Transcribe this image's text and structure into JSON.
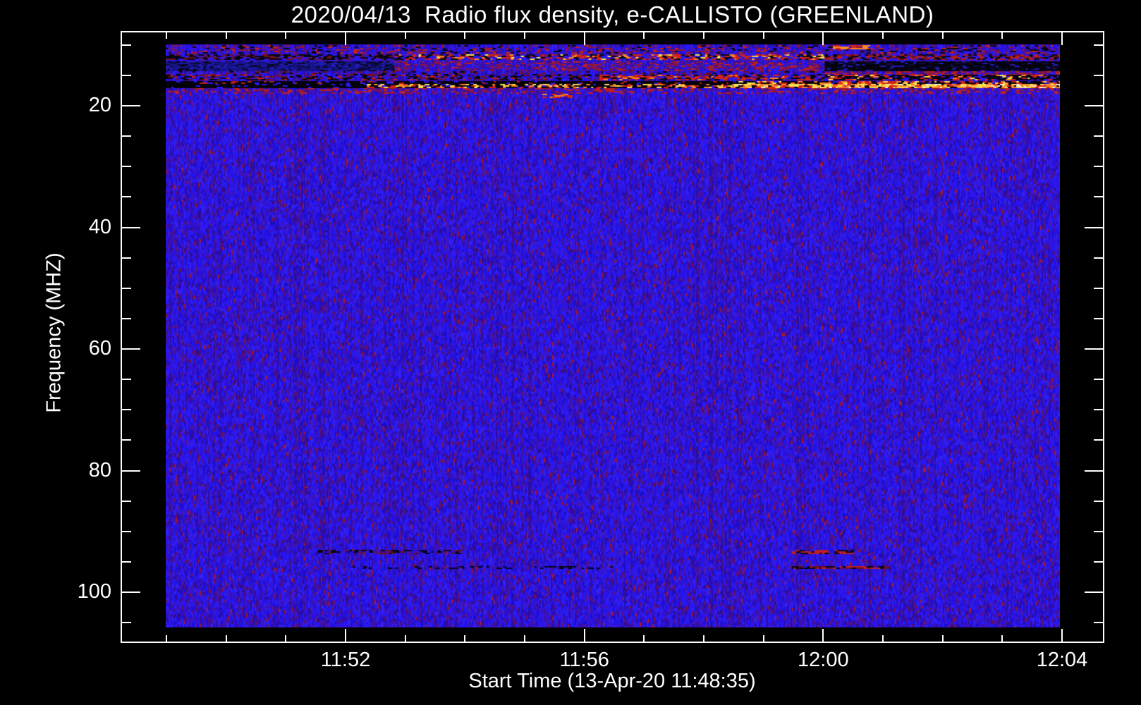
{
  "chart_data": {
    "type": "heatmap",
    "title": "2020/04/13  Radio flux density, e-CALLISTO (GREENLAND)",
    "xlabel": "Start Time (13-Apr-20 11:48:35)",
    "ylabel": "Frequency (MHZ)",
    "date": "2020/04/13",
    "instrument": "e-CALLISTO (GREENLAND)",
    "x_axis": {
      "start_time_label": "11:48:35",
      "major_ticks": [
        {
          "minute": 4,
          "label": "11:52"
        },
        {
          "minute": 8,
          "label": "11:56"
        },
        {
          "minute": 12,
          "label": "12:00"
        },
        {
          "minute": 16,
          "label": "12:04"
        }
      ],
      "minor_tick_every_minutes": 1
    },
    "y_axis": {
      "unit": "MHz",
      "direction": "increasing-downward",
      "major_ticks": [
        {
          "freq": 20,
          "label": "20"
        },
        {
          "freq": 40,
          "label": "40"
        },
        {
          "freq": 60,
          "label": "60"
        },
        {
          "freq": 80,
          "label": "80"
        },
        {
          "freq": 100,
          "label": "100"
        }
      ],
      "minor_tick_every": 5,
      "minor_range": [
        10,
        105
      ],
      "data_freq_range": [
        10,
        106
      ]
    },
    "colormap": {
      "description": "blue background noise, red-orange-yellow for strong flux, black for low flux",
      "background_blue": "#2a17ee",
      "strong_red": "#d42410",
      "strong_orange": "#ff8820",
      "strong_yellow": "#ffe44e",
      "low_black": "#020208",
      "base_noise": [
        [
          "#2a17ee",
          0.28
        ],
        [
          "#2311e2",
          0.17
        ],
        [
          "#3020f4",
          0.13
        ],
        [
          "#1c0dc8",
          0.08
        ],
        [
          "#3915cc",
          0.11
        ],
        [
          "#43109e",
          0.09
        ],
        [
          "#350b8c",
          0.06
        ],
        [
          "#55107a",
          0.04
        ],
        [
          "#6e105a",
          0.02
        ],
        [
          "#8a1540",
          0.013
        ],
        [
          "#a5182e",
          0.007
        ]
      ],
      "dark_column": [
        [
          "#2e0e9a",
          0.4
        ],
        [
          "#1c0dc8",
          0.25
        ],
        [
          "#43109e",
          0.2
        ],
        [
          "#55107a",
          0.15
        ]
      ]
    },
    "rfi_bands": [
      {
        "f0": 10.05,
        "f1": 11.3,
        "desc": "top row: blue with sparse red and black dashes",
        "segments": [
          {
            "x0": 0,
            "x1": 1,
            "palette": [
              [
                "none",
                0.72
              ],
              [
                "#8a1540",
                0.1
              ],
              [
                "#c02020",
                0.08
              ],
              [
                "#050510",
                0.1
              ]
            ]
          }
        ]
      },
      {
        "f0": 10.0,
        "f1": 10.7,
        "desc": "small orange dash cluster just left of 12:00",
        "segments": [
          {
            "x0": 0.746,
            "x1": 0.788,
            "palette": [
              [
                "#ff8820",
                0.45
              ],
              [
                "#d42410",
                0.3
              ],
              [
                "none",
                0.25
              ]
            ]
          }
        ]
      },
      {
        "f0": 11.5,
        "f1": 12.5,
        "desc": "RFI band ~12 MHz: dark left, bright red/yellow speckles mid, red right",
        "segments": [
          {
            "x0": 0,
            "x1": 0.256,
            "palette": [
              [
                "#050510",
                0.4
              ],
              [
                "#70101c",
                0.18
              ],
              [
                "#2a17ee",
                0.22
              ],
              [
                "#55107a",
                0.2
              ]
            ]
          },
          {
            "x0": 0.256,
            "x1": 0.737,
            "palette": [
              [
                "#d42410",
                0.2
              ],
              [
                "#ff8820",
                0.1
              ],
              [
                "#ffe44e",
                0.07
              ],
              [
                "#050510",
                0.2
              ],
              [
                "#2a17ee",
                0.28
              ],
              [
                "#8a1540",
                0.15
              ]
            ]
          },
          {
            "x0": 0.737,
            "x1": 1,
            "palette": [
              [
                "#b81e14",
                0.22
              ],
              [
                "#70101c",
                0.2
              ],
              [
                "#050510",
                0.28
              ],
              [
                "#2a17ee",
                0.3
              ]
            ]
          }
        ]
      },
      {
        "f0": 12.7,
        "f1": 14.3,
        "desc": "~13 MHz: dark wash left, faint red middle, solid black band right of 12:00",
        "segments": [
          {
            "x0": 0,
            "x1": 0.256,
            "palette": [
              [
                "#151283",
                0.45
              ],
              [
                "#0a0a3c",
                0.25
              ],
              [
                "#221bb0",
                0.2
              ],
              [
                "#05050f",
                0.1
              ]
            ]
          },
          {
            "x0": 0.256,
            "x1": 0.737,
            "palette": [
              [
                "none",
                0.55
              ],
              [
                "#8a1540",
                0.2
              ],
              [
                "#c02020",
                0.1
              ],
              [
                "#43109e",
                0.15
              ]
            ]
          },
          {
            "x0": 0.737,
            "x1": 1,
            "palette": [
              [
                "#020208",
                0.78
              ],
              [
                "#0d0d35",
                0.12
              ],
              [
                "#221bb0",
                0.1
              ]
            ]
          }
        ]
      },
      {
        "f0": 14.3,
        "f1": 14.9,
        "desc": "faint red dash row, stronger right of 12:00",
        "segments": [
          {
            "x0": 0,
            "x1": 0.737,
            "palette": [
              [
                "none",
                0.8
              ],
              [
                "#70101c",
                0.12
              ],
              [
                "#050510",
                0.08
              ]
            ]
          },
          {
            "x0": 0.737,
            "x1": 1,
            "palette": [
              [
                "#c02020",
                0.25
              ],
              [
                "#8a1540",
                0.2
              ],
              [
                "none",
                0.55
              ]
            ]
          }
        ]
      },
      {
        "f0": 14.9,
        "f1": 15.8,
        "desc": "~15 MHz speckled dark/red line; black right of 12:00",
        "segments": [
          {
            "x0": 0,
            "x1": 0.485,
            "palette": [
              [
                "#050510",
                0.22
              ],
              [
                "#70101c",
                0.15
              ],
              [
                "none",
                0.55
              ],
              [
                "#c02020",
                0.08
              ]
            ]
          },
          {
            "x0": 0.485,
            "x1": 0.737,
            "palette": [
              [
                "#d42410",
                0.3
              ],
              [
                "#ff8820",
                0.06
              ],
              [
                "#050510",
                0.22
              ],
              [
                "none",
                0.35
              ],
              [
                "#8a1540",
                0.07
              ]
            ]
          },
          {
            "x0": 0.737,
            "x1": 1,
            "palette": [
              [
                "#020208",
                0.6
              ],
              [
                "#d42410",
                0.16
              ],
              [
                "none",
                0.16
              ],
              [
                "#ff8820",
                0.05
              ],
              [
                "#ffe44e",
                0.03
              ]
            ]
          }
        ]
      },
      {
        "f0": 15.9,
        "f1": 16.4,
        "desc": "~16 MHz black band upper part with growing bright dashes",
        "segments": [
          {
            "x0": 0,
            "x1": 0.635,
            "palette": [
              [
                "#020208",
                0.8
              ],
              [
                "#b81e14",
                0.1
              ],
              [
                "#2a17ee",
                0.1
              ]
            ]
          },
          {
            "x0": 0.635,
            "x1": 1,
            "palette": [
              [
                "#020208",
                0.45
              ],
              [
                "#d42410",
                0.22
              ],
              [
                "#ff8820",
                0.15
              ],
              [
                "#ffe44e",
                0.1
              ],
              [
                "#2a17ee",
                0.08
              ]
            ]
          }
        ]
      },
      {
        "f0": 16.4,
        "f1": 17.0,
        "desc": "brightest band ~17 MHz: solid black left, yellow/orange speckles toward right",
        "segments": [
          {
            "x0": 0,
            "x1": 0.225,
            "palette": [
              [
                "#020208",
                0.9
              ],
              [
                "#2a17ee",
                0.1
              ]
            ]
          },
          {
            "x0": 0.225,
            "x1": 0.635,
            "palette": [
              [
                "#020208",
                0.45
              ],
              [
                "#ffe44e",
                0.2
              ],
              [
                "#ff8820",
                0.15
              ],
              [
                "#d42410",
                0.15
              ],
              [
                "#2a17ee",
                0.05
              ]
            ]
          },
          {
            "x0": 0.635,
            "x1": 1,
            "palette": [
              [
                "#ffe44e",
                0.38
              ],
              [
                "#ff8820",
                0.28
              ],
              [
                "#d42410",
                0.15
              ],
              [
                "#020208",
                0.12
              ],
              [
                "#fff8c0",
                0.07
              ]
            ]
          }
        ]
      },
      {
        "f0": 17.1,
        "f1": 17.9,
        "desc": "blue with moderate red speckles below bright band",
        "segments": [
          {
            "x0": 0,
            "x1": 1,
            "palette": [
              [
                "none",
                0.6
              ],
              [
                "#c02020",
                0.15
              ],
              [
                "#8a1540",
                0.13
              ],
              [
                "#43109e",
                0.12
              ]
            ]
          }
        ]
      },
      {
        "f0": 18.0,
        "f1": 18.7,
        "desc": "small orange dash cluster near 11:55",
        "segments": [
          {
            "x0": 0.421,
            "x1": 0.455,
            "palette": [
              [
                "#ff8820",
                0.4
              ],
              [
                "#d42410",
                0.35
              ],
              [
                "none",
                0.25
              ]
            ]
          }
        ]
      },
      {
        "f0": 93.1,
        "f1": 93.6,
        "desc": "faint interference line ~93 MHz with red dashes near 12:00",
        "segments": [
          {
            "x0": 0.17,
            "x1": 0.33,
            "palette": [
              [
                "#050510",
                0.3
              ],
              [
                "#70101c",
                0.2
              ],
              [
                "none",
                0.5
              ]
            ]
          },
          {
            "x0": 0.7,
            "x1": 0.77,
            "palette": [
              [
                "#c02020",
                0.4
              ],
              [
                "#050510",
                0.25
              ],
              [
                "none",
                0.35
              ]
            ]
          }
        ]
      },
      {
        "f0": 95.7,
        "f1": 96.2,
        "desc": "faint interference line ~96 MHz with dark/red dashes near 12:00",
        "segments": [
          {
            "x0": 0.2,
            "x1": 0.5,
            "palette": [
              [
                "#050510",
                0.2
              ],
              [
                "none",
                0.8
              ]
            ]
          },
          {
            "x0": 0.7,
            "x1": 0.81,
            "palette": [
              [
                "#050510",
                0.35
              ],
              [
                "#c02020",
                0.3
              ],
              [
                "#70101c",
                0.2
              ],
              [
                "none",
                0.15
              ]
            ]
          }
        ]
      }
    ]
  }
}
